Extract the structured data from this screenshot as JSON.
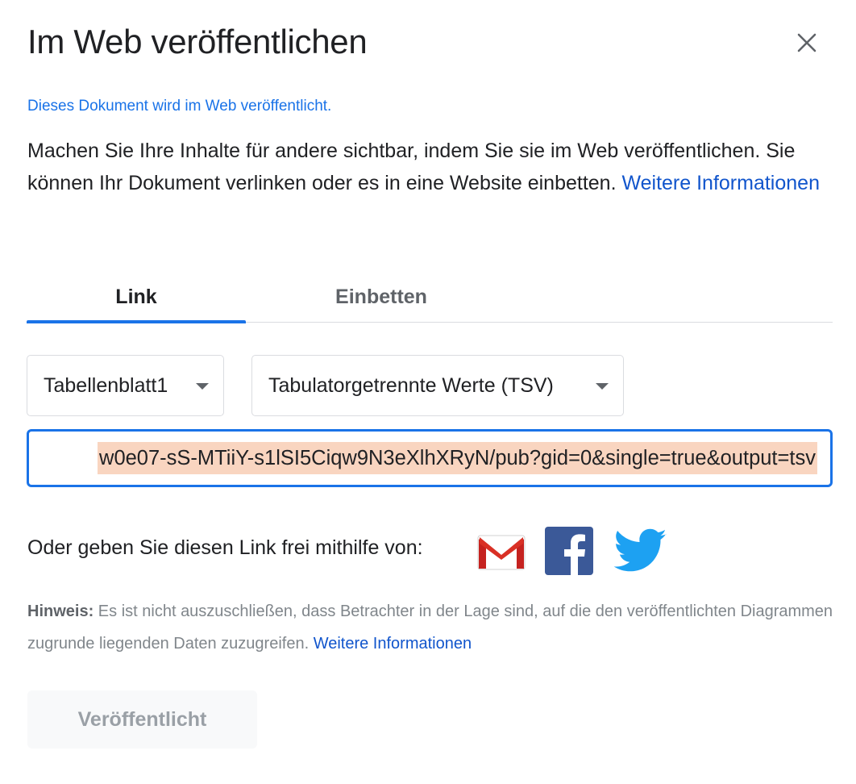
{
  "dialog": {
    "title": "Im Web veröffentlichen",
    "status": "Dieses Dokument wird im Web veröffentlicht.",
    "description": "Machen Sie Ihre Inhalte für andere sichtbar, indem Sie sie im Web veröffentlichen. Sie können Ihr Dokument verlinken oder es in eine Website einbetten.",
    "learn_more": "Weitere Informationen"
  },
  "tabs": [
    {
      "label": "Link",
      "active": true
    },
    {
      "label": "Einbetten",
      "active": false
    }
  ],
  "selects": {
    "sheet": "Tabellenblatt1",
    "format": "Tabulatorgetrennte Werte (TSV)"
  },
  "url": {
    "value": "w0e07-sS-MTiiY-s1lSI5Ciqw9N3eXlhXRyN/pub?gid=0&single=true&output=tsv"
  },
  "share": {
    "label": "Oder geben Sie diesen Link frei mithilfe von:",
    "icons": [
      "gmail-icon",
      "facebook-icon",
      "twitter-icon"
    ]
  },
  "note": {
    "prefix": "Hinweis:",
    "text": " Es ist nicht auszuschließen, dass Betrachter in der Lage sind, auf die den veröffentlichten Diagrammen zugrunde liegenden Daten zuzugreifen.",
    "learn_more": "Weitere Informationen"
  },
  "button": {
    "published": "Veröffentlicht"
  },
  "colors": {
    "accent": "#1a73e8",
    "link": "#1155cc",
    "selection": "#f9d5c0",
    "gmail_red": "#d93025",
    "facebook_blue": "#3b5998",
    "twitter_blue": "#1da1f2"
  }
}
